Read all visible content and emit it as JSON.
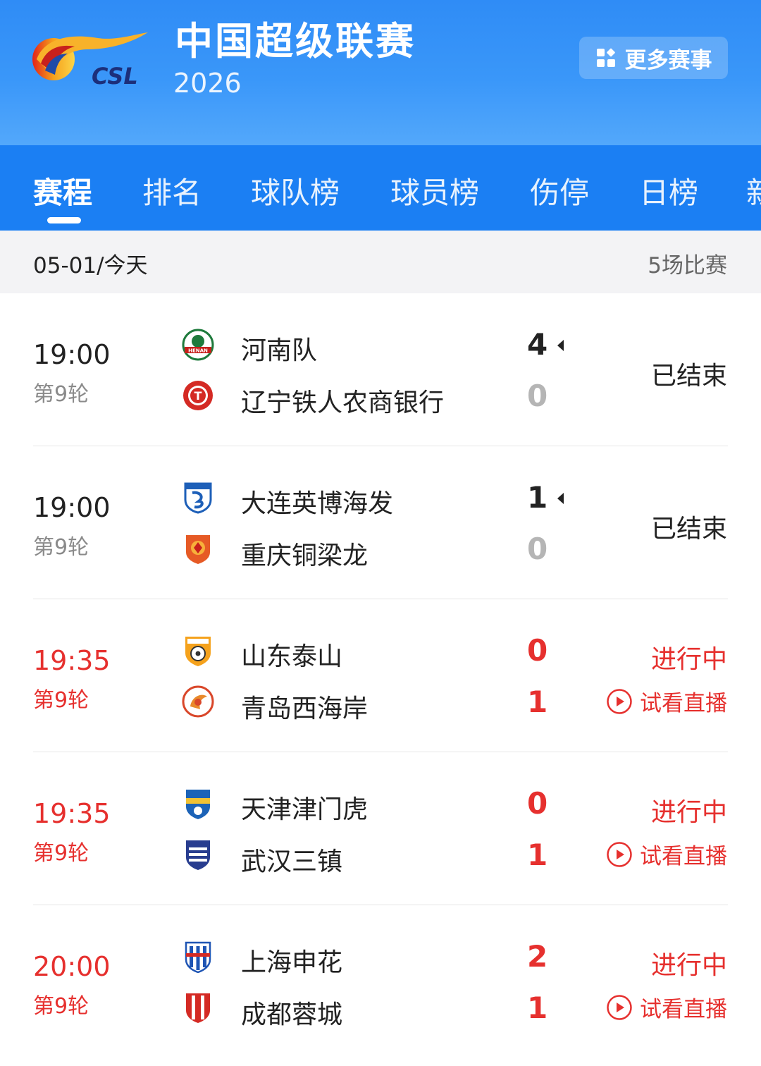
{
  "header": {
    "logo_text": "CSL",
    "title": "中国超级联赛",
    "season": "2026",
    "more_button": "更多赛事"
  },
  "tabs": [
    {
      "label": "赛程",
      "active": true
    },
    {
      "label": "排名",
      "active": false
    },
    {
      "label": "球队榜",
      "active": false
    },
    {
      "label": "球员榜",
      "active": false
    },
    {
      "label": "伤停",
      "active": false
    },
    {
      "label": "日榜",
      "active": false
    },
    {
      "label": "新",
      "active": false
    }
  ],
  "date_bar": {
    "date": "05-01/今天",
    "count": "5场比赛"
  },
  "colors": {
    "header_blue": "#2f8cf6",
    "tab_blue": "#1b7ff3",
    "live_red": "#e6302e",
    "muted_gray": "#8a8a8a"
  },
  "matches": [
    {
      "time": "19:00",
      "round": "第9轮",
      "state": "finished",
      "home": {
        "name": "河南队",
        "score": "4",
        "badge": "henan-badge-icon"
      },
      "away": {
        "name": "辽宁铁人农商银行",
        "score": "0",
        "badge": "liaoning-badge-icon"
      },
      "status": "已结束",
      "watch": ""
    },
    {
      "time": "19:00",
      "round": "第9轮",
      "state": "finished",
      "home": {
        "name": "大连英博海发",
        "score": "1",
        "badge": "dalian-badge-icon"
      },
      "away": {
        "name": "重庆铜梁龙",
        "score": "0",
        "badge": "chongqing-badge-icon"
      },
      "status": "已结束",
      "watch": ""
    },
    {
      "time": "19:35",
      "round": "第9轮",
      "state": "live",
      "home": {
        "name": "山东泰山",
        "score": "0",
        "badge": "shandong-badge-icon"
      },
      "away": {
        "name": "青岛西海岸",
        "score": "1",
        "badge": "qingdao-badge-icon"
      },
      "status": "进行中",
      "watch": "试看直播"
    },
    {
      "time": "19:35",
      "round": "第9轮",
      "state": "live",
      "home": {
        "name": "天津津门虎",
        "score": "0",
        "badge": "tianjin-badge-icon"
      },
      "away": {
        "name": "武汉三镇",
        "score": "1",
        "badge": "wuhan-badge-icon"
      },
      "status": "进行中",
      "watch": "试看直播"
    },
    {
      "time": "20:00",
      "round": "第9轮",
      "state": "live",
      "home": {
        "name": "上海申花",
        "score": "2",
        "badge": "shanghai-badge-icon"
      },
      "away": {
        "name": "成都蓉城",
        "score": "1",
        "badge": "chengdu-badge-icon"
      },
      "status": "进行中",
      "watch": "试看直播"
    }
  ]
}
